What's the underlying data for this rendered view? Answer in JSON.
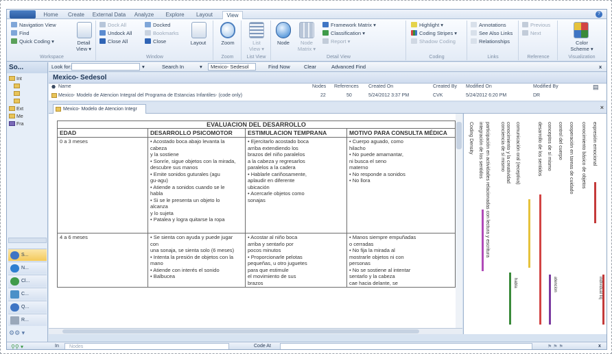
{
  "ribbon_tabs": [
    "Home",
    "Create",
    "External Data",
    "Analyze",
    "Explore",
    "Layout",
    "View"
  ],
  "active_tab": "View",
  "groups": {
    "workspace": {
      "label": "Workspace",
      "items": [
        "Navigation View",
        "Find",
        "Quick Coding ▾"
      ],
      "detail": "Detail",
      "view": "View ▾"
    },
    "window": {
      "label": "Window",
      "items": [
        "Dock All",
        "Undock All",
        "Close All"
      ],
      "items2": [
        "Docked",
        "Bookmarks",
        "Close"
      ],
      "layout": "Layout"
    },
    "zoom": {
      "label": "Zoom",
      "btn": "Zoom"
    },
    "listview": {
      "label": "List View",
      "btn": "List",
      "btn2": "View ▾"
    },
    "detailview": {
      "label": "Detail View",
      "node": "Node",
      "nodematrix": "Node",
      "nodematrix2": "Matrix ▾",
      "items": [
        "Framework Matrix ▾",
        "Classification ▾",
        "Report ▾"
      ]
    },
    "coding": {
      "label": "Coding",
      "items": [
        "Highlight ▾",
        "Coding Stripes ▾",
        "Shadow Coding"
      ]
    },
    "links": {
      "label": "Links",
      "items": [
        "Annotations",
        "See Also Links",
        "Relationships"
      ]
    },
    "reference": {
      "label": "Reference",
      "items": [
        "Previous",
        "Next"
      ]
    },
    "visualization": {
      "label": "Visualization",
      "btn": "Color",
      "btn2": "Scheme ▾"
    }
  },
  "nav": {
    "title": "So...",
    "tree": [
      "Int",
      "",
      "",
      "Ext",
      "Me",
      "Fra"
    ],
    "buttons": [
      "S...",
      "N...",
      "Cl...",
      "C...",
      "Q...",
      "R..."
    ]
  },
  "findbar": {
    "lookfor": "Look for:",
    "searchin": "Search In",
    "scope": "Mexico- Sedesol",
    "findnow": "Find Now",
    "clear": "Clear",
    "advanced": "Advanced Find",
    "close": "x"
  },
  "detail_title": "Mexico- Sedesol",
  "node_table": {
    "headers": {
      "name": "Name",
      "nodes": "Nodes",
      "references": "References",
      "created_on": "Created On",
      "created_by": "Created By",
      "modified_on": "Modified On",
      "modified_by": "Modified By"
    },
    "row": {
      "name": "Mexico- Modelo de Atencion Integral del Programa de Estancias Infantiles- (code only)",
      "nodes": "22",
      "references": "50",
      "created_on": "5/24/2012 3:37 PM",
      "created_by": "CVK",
      "modified_on": "5/24/2012 6:20 PM",
      "modified_by": "DR"
    }
  },
  "doc_tab": "Mexico- Modelo de Atencion Integr",
  "doc": {
    "title": "EVALUACION DEL DESARROLLO",
    "headers": [
      "EDAD",
      "DESARROLLO PSICOMOTOR",
      "ESTIMULACION TEMPRANA",
      "MOTIVO PARA CONSULTA MÉDICA"
    ],
    "rows": [
      {
        "edad": "0 a 3 meses",
        "psicomotor": [
          "• Acostado boca abajo levanta la",
          "cabeza",
          "y la sostiene",
          "• Sonríe, sigue objetos con la mirada,",
          "descubre sus manos",
          "• Emite sonidos guturales (agu",
          "gu-agu)",
          "• Atiende a sonidos cuando se le",
          "habla",
          "• Si se le presenta un objeto lo",
          "alcanza",
          "y lo sujeta",
          "• Patalea y logra quitarse la ropa"
        ],
        "estimulacion": [
          "• Ejercitarlo acostado boca",
          "arriba extendiendo los",
          "brazos del niño paralelos",
          "a la cabeza y regresarlos",
          "paralelos a la cadera",
          "• Hablarle cariñosamente,",
          "aplaudir en diferente",
          "ubicación",
          "• Acercarle objetos como",
          "sonajas"
        ],
        "motivo": [
          "• Cuerpo aguado, como",
          "hilacho",
          "• No puede amamantar,",
          "ni busca el seno",
          "materno",
          "• No responde a sonidos",
          "• No llora"
        ]
      },
      {
        "edad": "4 a 6 meses",
        "psicomotor": [
          "• Se sienta con ayuda y puede jugar",
          "con",
          "una sonaja, se sienta solo (6 meses)",
          "• Intenta la presión de objetos con la",
          "mano",
          "• Atiende con interés el sonido",
          "• Balbucea"
        ],
        "estimulacion": [
          "• Acostar al niño boca",
          "arriba y sentarlo por",
          "pocos minutos",
          "• Proporcionarle pelotas",
          "pequeñas, u otro juguetes",
          "para que estimule",
          "el movimiento de sus",
          "brazos"
        ],
        "motivo": [
          "• Manos siempre empuñadas",
          "o cerradas",
          "• No fija la mirada al",
          "mostrarle objetos ni con",
          "personas",
          "• No se sostiene al intentar",
          "sentarlo y la cabeza",
          "cae hacia delante, se"
        ]
      }
    ]
  },
  "coding_stripes": {
    "labels": [
      "Coding Density",
      "integración de los sentidos",
      "participación en actividades relacionadas con lectura y escritura",
      "conciencia de sí mismo",
      "conocimiento y la creatividad",
      "comunicación oral (receptiva)",
      "desarrollo de los sentidos",
      "conceptos de sí mismo",
      "control del cuerpo",
      "cooperación en tareas de cuidado",
      "conocimiento básico de objetos",
      "expresión emocional"
    ],
    "bar_texts": [
      "habla",
      "atencion",
      "individual líq"
    ],
    "colors": [
      "#b04ab8",
      "#d24444",
      "#e6c23c",
      "#3a8a3a",
      "#7a3aa0",
      "#c43a3a"
    ]
  },
  "bottombar": {
    "in": "In",
    "nodes": "Nodes",
    "code_at": "Code At",
    "close": "x"
  }
}
